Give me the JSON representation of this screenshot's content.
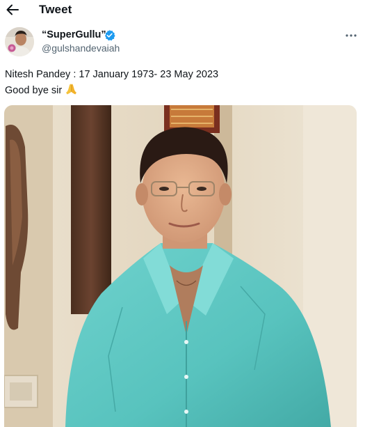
{
  "header": {
    "title": "Tweet",
    "back_icon": "arrow-left-icon"
  },
  "author": {
    "display_name": "“SuperGullu”",
    "handle": "@gulshandevaiah",
    "verified_icon": "verified-badge-icon",
    "verified_color": "#1d9bf0",
    "more_icon": "more-horizontal-icon"
  },
  "tweet": {
    "line1": "Nitesh Pandey : 17 January 1973- 23 May 2023",
    "line2": "Good bye sir",
    "emoji_icon": "folded-hands-emoji-icon"
  },
  "media": {
    "type": "photo",
    "subject": "portrait"
  },
  "colors": {
    "text_primary": "#0f1419",
    "text_secondary": "#536471",
    "accent": "#1d9bf0",
    "shirt": "#5ec9c4"
  }
}
